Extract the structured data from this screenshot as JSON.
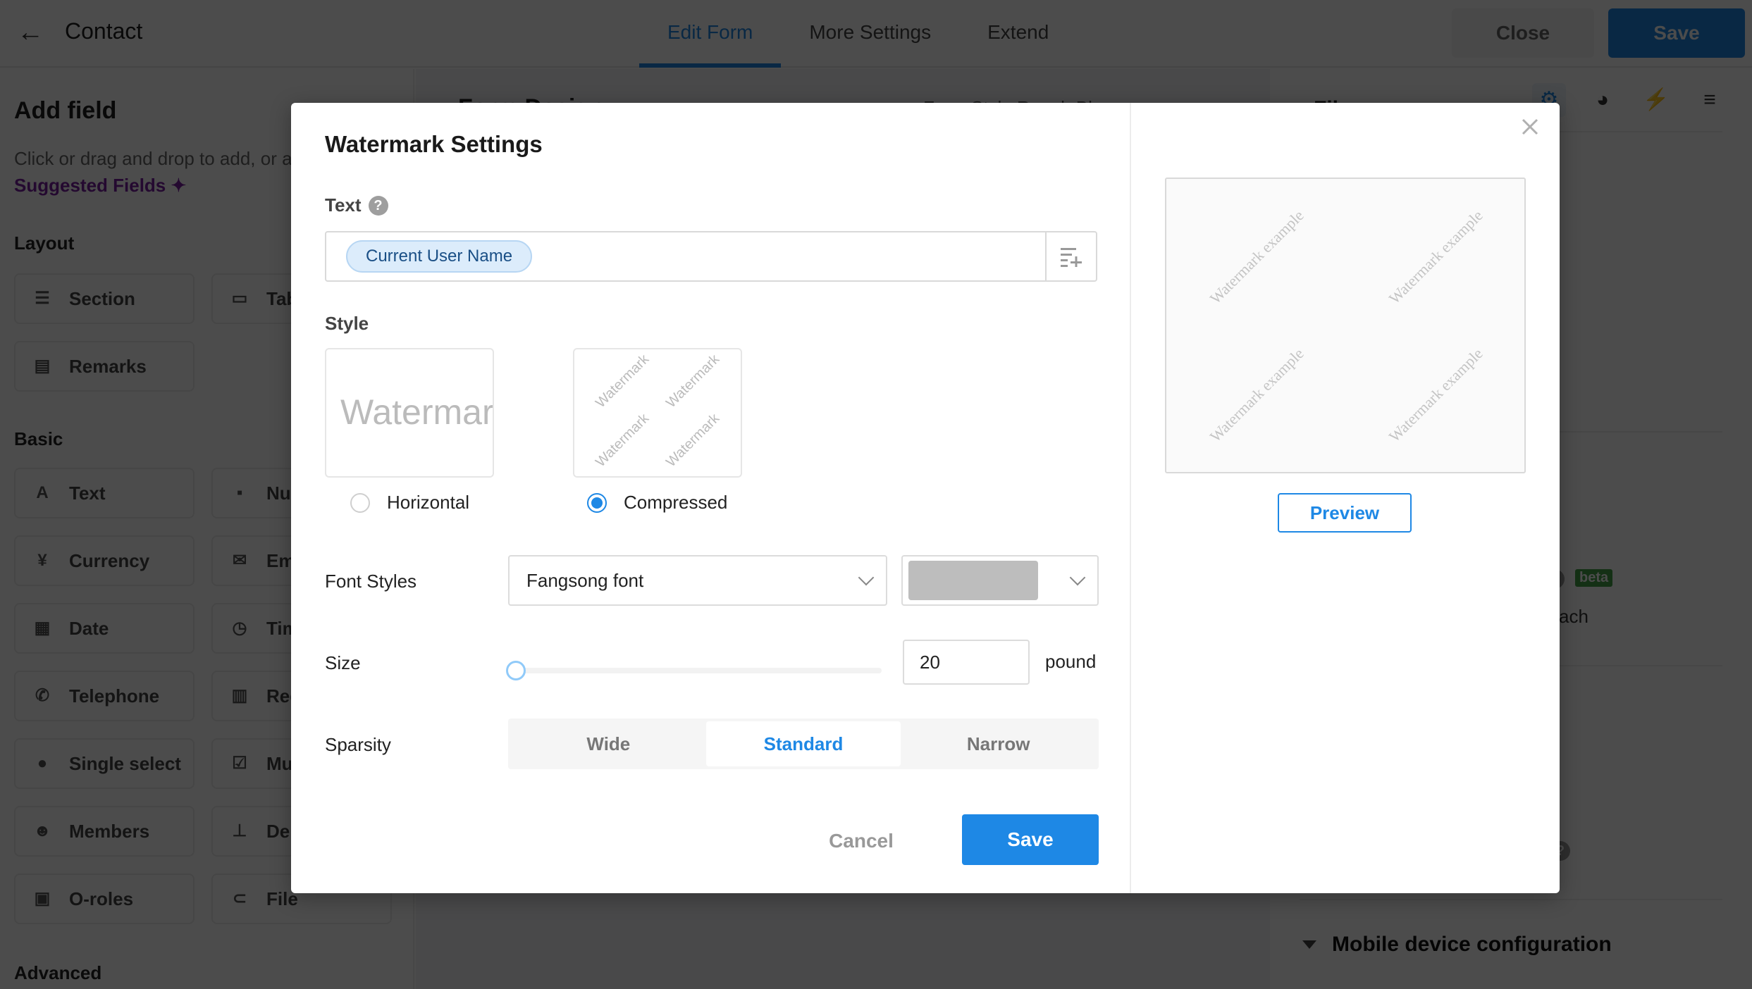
{
  "app": {
    "back_icon": "arrow-left-icon",
    "title": "Contact",
    "tabs": [
      {
        "label": "Edit Form",
        "active": true
      },
      {
        "label": "More Settings",
        "active": false
      },
      {
        "label": "Extend",
        "active": false
      }
    ],
    "close_label": "Close",
    "save_label": "Save"
  },
  "left_panel": {
    "title": "Add field",
    "hint": "Click or drag and drop to add, or a",
    "suggested": "Suggested Fields ✦",
    "sections": {
      "layout": "Layout",
      "basic": "Basic",
      "advanced": "Advanced"
    },
    "layout_fields": [
      {
        "label": "Section",
        "icon": "section-icon"
      },
      {
        "label": "Tab",
        "icon": "tab-icon"
      },
      {
        "label": "Remarks",
        "icon": "remarks-icon"
      }
    ],
    "basic_fields": [
      {
        "label": "Text",
        "icon": "text-icon"
      },
      {
        "label": "Nu",
        "icon": "number-icon"
      },
      {
        "label": "Currency",
        "icon": "currency-icon"
      },
      {
        "label": "Em",
        "icon": "email-icon"
      },
      {
        "label": "Date",
        "icon": "date-icon"
      },
      {
        "label": "Tim",
        "icon": "time-icon"
      },
      {
        "label": "Telephone",
        "icon": "phone-icon"
      },
      {
        "label": "Reg",
        "icon": "region-icon"
      },
      {
        "label": "Single select",
        "icon": "single-select-icon"
      },
      {
        "label": "Mul sele",
        "icon": "multi-select-icon"
      },
      {
        "label": "Members",
        "icon": "members-icon"
      },
      {
        "label": "Dep",
        "icon": "department-icon"
      },
      {
        "label": "O-roles",
        "icon": "roles-icon"
      },
      {
        "label": "File",
        "icon": "paperclip-icon"
      }
    ]
  },
  "canvas": {
    "title": "Form Design",
    "tools": "Form Style   Rough Bl"
  },
  "right_panel": {
    "header": "Fil",
    "icons": [
      "gear-icon",
      "palette-icon",
      "lightning-icon",
      "sort-icon"
    ],
    "beta_badge": "beta",
    "description": "own uploaded attach",
    "mobile_section": "Mobile device configuration"
  },
  "modal": {
    "title": "Watermark Settings",
    "text_label": "Text",
    "text_chip": "Current User Name",
    "style_label": "Style",
    "style_options": [
      {
        "label": "Horizontal",
        "sample": "Watermark",
        "selected": false
      },
      {
        "label": "Compressed",
        "sample": "Watermark",
        "selected": true
      }
    ],
    "font_styles_label": "Font Styles",
    "font_value": "Fangsong font",
    "font_color": "#bdbdbd",
    "size_label": "Size",
    "size_value": "20",
    "size_slider_fraction": 0.02,
    "size_unit": "pound",
    "sparsity_label": "Sparsity",
    "sparsity_options": [
      {
        "label": "Wide",
        "active": false
      },
      {
        "label": "Standard",
        "active": true
      },
      {
        "label": "Narrow",
        "active": false
      }
    ],
    "cancel_label": "Cancel",
    "save_label": "Save",
    "preview_text": "Watermark example",
    "preview_button": "Preview"
  }
}
